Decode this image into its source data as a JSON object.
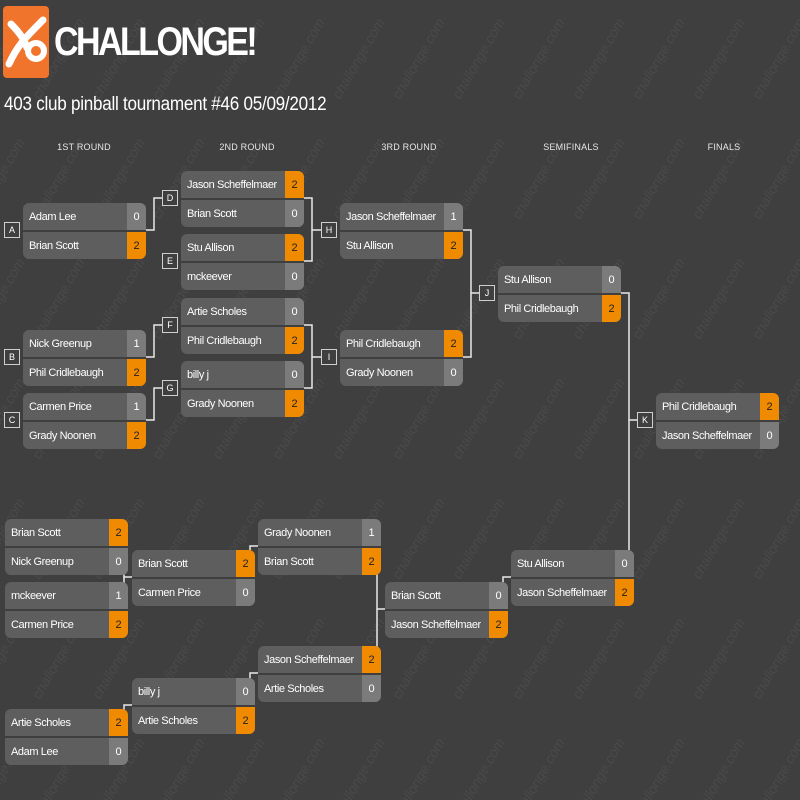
{
  "brand": {
    "logo_text": "CHALLONGE!",
    "watermark_text": "challonge.com",
    "accent_color": "#f0742b",
    "win_color": "#f08a00"
  },
  "tournament": {
    "title": "403 club pinball tournament #46 05/09/2012"
  },
  "rounds": [
    "1ST ROUND",
    "2ND ROUND",
    "3RD ROUND",
    "SEMIFINALS",
    "FINALS"
  ],
  "winners_matches": [
    {
      "label": "A",
      "p1": {
        "name": "Adam Lee",
        "score": "0"
      },
      "p2": {
        "name": "Brian Scott",
        "score": "2"
      },
      "winner": 2
    },
    {
      "label": "B",
      "p1": {
        "name": "Nick Greenup",
        "score": "1"
      },
      "p2": {
        "name": "Phil Cridlebaugh",
        "score": "2"
      },
      "winner": 2
    },
    {
      "label": "C",
      "p1": {
        "name": "Carmen Price",
        "score": "1"
      },
      "p2": {
        "name": "Grady Noonen",
        "score": "2"
      },
      "winner": 2
    },
    {
      "label": "D",
      "p1": {
        "name": "Jason Scheffelmaer",
        "score": "2"
      },
      "p2": {
        "name": "Brian Scott",
        "score": "0"
      },
      "winner": 1
    },
    {
      "label": "E",
      "p1": {
        "name": "Stu Allison",
        "score": "2"
      },
      "p2": {
        "name": "mckeever",
        "score": "0"
      },
      "winner": 1
    },
    {
      "label": "F",
      "p1": {
        "name": "Artie Scholes",
        "score": "0"
      },
      "p2": {
        "name": "Phil Cridlebaugh",
        "score": "2"
      },
      "winner": 2
    },
    {
      "label": "G",
      "p1": {
        "name": "billy j",
        "score": "0"
      },
      "p2": {
        "name": "Grady Noonen",
        "score": "2"
      },
      "winner": 2
    },
    {
      "label": "H",
      "p1": {
        "name": "Jason Scheffelmaer",
        "score": "1"
      },
      "p2": {
        "name": "Stu Allison",
        "score": "2"
      },
      "winner": 2
    },
    {
      "label": "I",
      "p1": {
        "name": "Phil Cridlebaugh",
        "score": "2"
      },
      "p2": {
        "name": "Grady Noonen",
        "score": "0"
      },
      "winner": 1
    },
    {
      "label": "J",
      "p1": {
        "name": "Stu Allison",
        "score": "0"
      },
      "p2": {
        "name": "Phil Cridlebaugh",
        "score": "2"
      },
      "winner": 2
    },
    {
      "label": "K",
      "p1": {
        "name": "Phil Cridlebaugh",
        "score": "2"
      },
      "p2": {
        "name": "Jason Scheffelmaer",
        "score": "0"
      },
      "winner": 1
    }
  ],
  "losers_matches": [
    {
      "p1": {
        "name": "Brian Scott",
        "score": "2"
      },
      "p2": {
        "name": "Nick Greenup",
        "score": "0"
      },
      "winner": 1
    },
    {
      "p1": {
        "name": "mckeever",
        "score": "1"
      },
      "p2": {
        "name": "Carmen Price",
        "score": "2"
      },
      "winner": 2
    },
    {
      "p1": {
        "name": "Artie Scholes",
        "score": "2"
      },
      "p2": {
        "name": "Adam Lee",
        "score": "0"
      },
      "winner": 1
    },
    {
      "p1": {
        "name": "Brian Scott",
        "score": "2"
      },
      "p2": {
        "name": "Carmen Price",
        "score": "0"
      },
      "winner": 1
    },
    {
      "p1": {
        "name": "billy j",
        "score": "0"
      },
      "p2": {
        "name": "Artie Scholes",
        "score": "2"
      },
      "winner": 2
    },
    {
      "p1": {
        "name": "Grady Noonen",
        "score": "1"
      },
      "p2": {
        "name": "Brian Scott",
        "score": "2"
      },
      "winner": 2
    },
    {
      "p1": {
        "name": "Jason Scheffelmaer",
        "score": "2"
      },
      "p2": {
        "name": "Artie Scholes",
        "score": "0"
      },
      "winner": 1
    },
    {
      "p1": {
        "name": "Brian Scott",
        "score": "0"
      },
      "p2": {
        "name": "Jason Scheffelmaer",
        "score": "2"
      },
      "winner": 2
    },
    {
      "p1": {
        "name": "Stu Allison",
        "score": "0"
      },
      "p2": {
        "name": "Jason Scheffelmaer",
        "score": "2"
      },
      "winner": 2
    }
  ]
}
